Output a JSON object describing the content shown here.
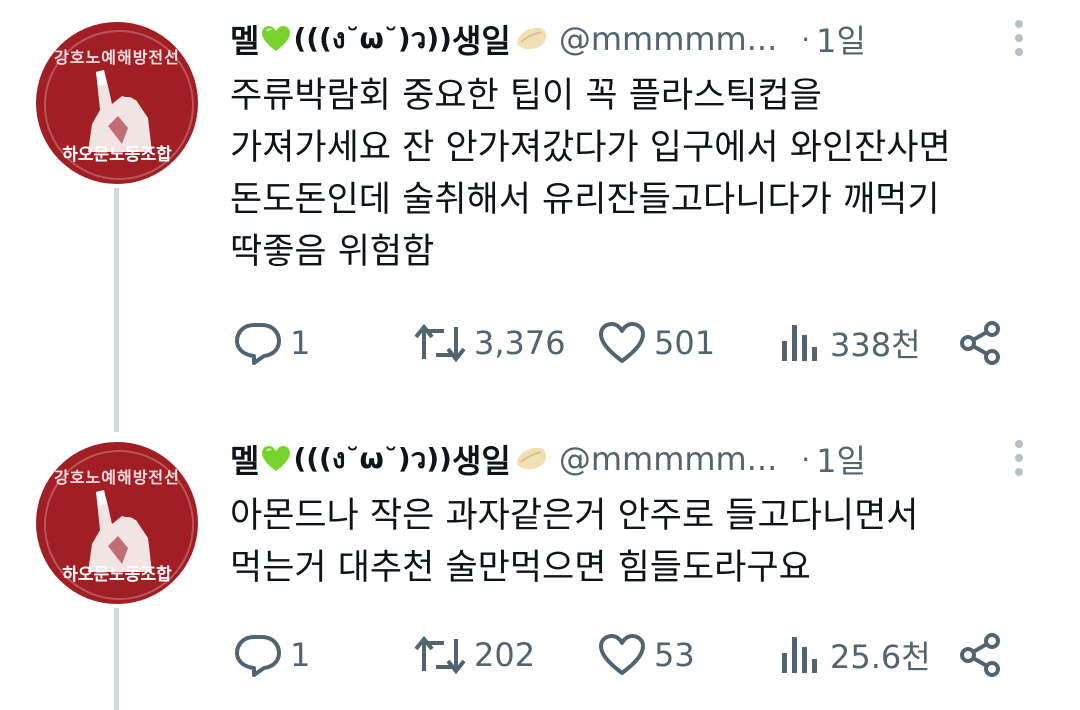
{
  "tweets": [
    {
      "author": {
        "kaomoji": "(((ง˘ω˘)ว))",
        "name_suffix": "생일",
        "name_prefix": "멜",
        "handle": "@mmmmm...",
        "avatar_top_text": "강호노예해방전선",
        "avatar_bottom_text": "하오문노동조합"
      },
      "dot": "·",
      "time": "1일",
      "lines": [
        "주류박람회 중요한 팁이 꼭 플라스틱컵을",
        "가져가세요 잔 안가져갔다가 입구에서 와인잔사면",
        "돈도돈인데 술취해서 유리잔들고다니다가 깨먹기",
        "딱좋음 위험함"
      ],
      "replies": "1",
      "retweets": "3,376",
      "likes": "501",
      "views": "338천"
    },
    {
      "author": {
        "kaomoji": "(((ง˘ω˘)ว))",
        "name_suffix": "생일",
        "name_prefix": "멜",
        "handle": "@mmmmm...",
        "avatar_top_text": "강호노예해방전선",
        "avatar_bottom_text": "하오문노동조합"
      },
      "dot": "·",
      "time": "1일",
      "lines": [
        "아몬드나 작은 과자같은거 안주로 들고다니면서",
        "먹는거 대추천 술만먹으면 힘들도라구요"
      ],
      "replies": "1",
      "retweets": "202",
      "likes": "53",
      "views": "25.6천"
    }
  ],
  "colors": {
    "text": "#0f1419",
    "muted": "#536471",
    "avatar_bg": "#a01e24",
    "thread_line": "#cfd9de",
    "heart": "#77d32d"
  }
}
